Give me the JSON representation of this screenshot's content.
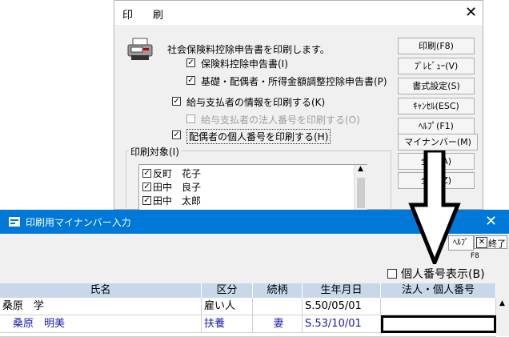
{
  "print_dialog": {
    "title": "印　刷",
    "message": "社会保険料控除申告書を印刷します。",
    "options": [
      {
        "label": "保険料控除申告書(I)",
        "checked": true,
        "enabled": true
      },
      {
        "label": "基礎・配偶者・所得金額調整控除申告書(P)",
        "checked": true,
        "enabled": true
      },
      {
        "label": "給与支払者の情報を印刷する(K)",
        "checked": true,
        "enabled": true
      },
      {
        "label": "給与支払者の法人番号を印刷する(O)",
        "checked": false,
        "enabled": false
      },
      {
        "label": "配偶者の個人番号を印刷する(H)",
        "checked": true,
        "enabled": true
      }
    ],
    "buttons": {
      "print": "印刷(F8)",
      "preview": "ﾌﾟﾚﾋﾞｭｰ(V)",
      "format": "書式設定(S)",
      "cancel": "ｷｬﾝｾﾙ(ESC)",
      "help": "ﾍﾙﾌﾟ(F1)",
      "mynumber": "マイナンバー(M)",
      "all1": "全　(A)",
      "all2": "全　(Z)"
    },
    "target_label": "印刷対象(I)",
    "targets": [
      {
        "name": "反町　花子",
        "checked": true
      },
      {
        "name": "田中　良子",
        "checked": true
      },
      {
        "name": "田中　太郎",
        "checked": true
      }
    ]
  },
  "mynumber_dialog": {
    "title": "印刷用マイナンバー入力",
    "help_label": "ﾍﾙﾌﾟ",
    "exit_label": "終了",
    "exit_shortcut": "F8",
    "show_number_label": "個人番号表示(B)",
    "columns": [
      "氏名",
      "区分",
      "続柄",
      "生年月日",
      "法人・個人番号"
    ],
    "rows": [
      {
        "name": "桑原　学",
        "kubun": "雇い人",
        "relation": "",
        "birth": "S.50/05/01",
        "number": ""
      },
      {
        "name": "　桑原　明美",
        "kubun": "扶養",
        "relation": "妻",
        "birth": "S.53/10/01",
        "number": ""
      }
    ]
  },
  "overlay_arrow": "down-arrow"
}
